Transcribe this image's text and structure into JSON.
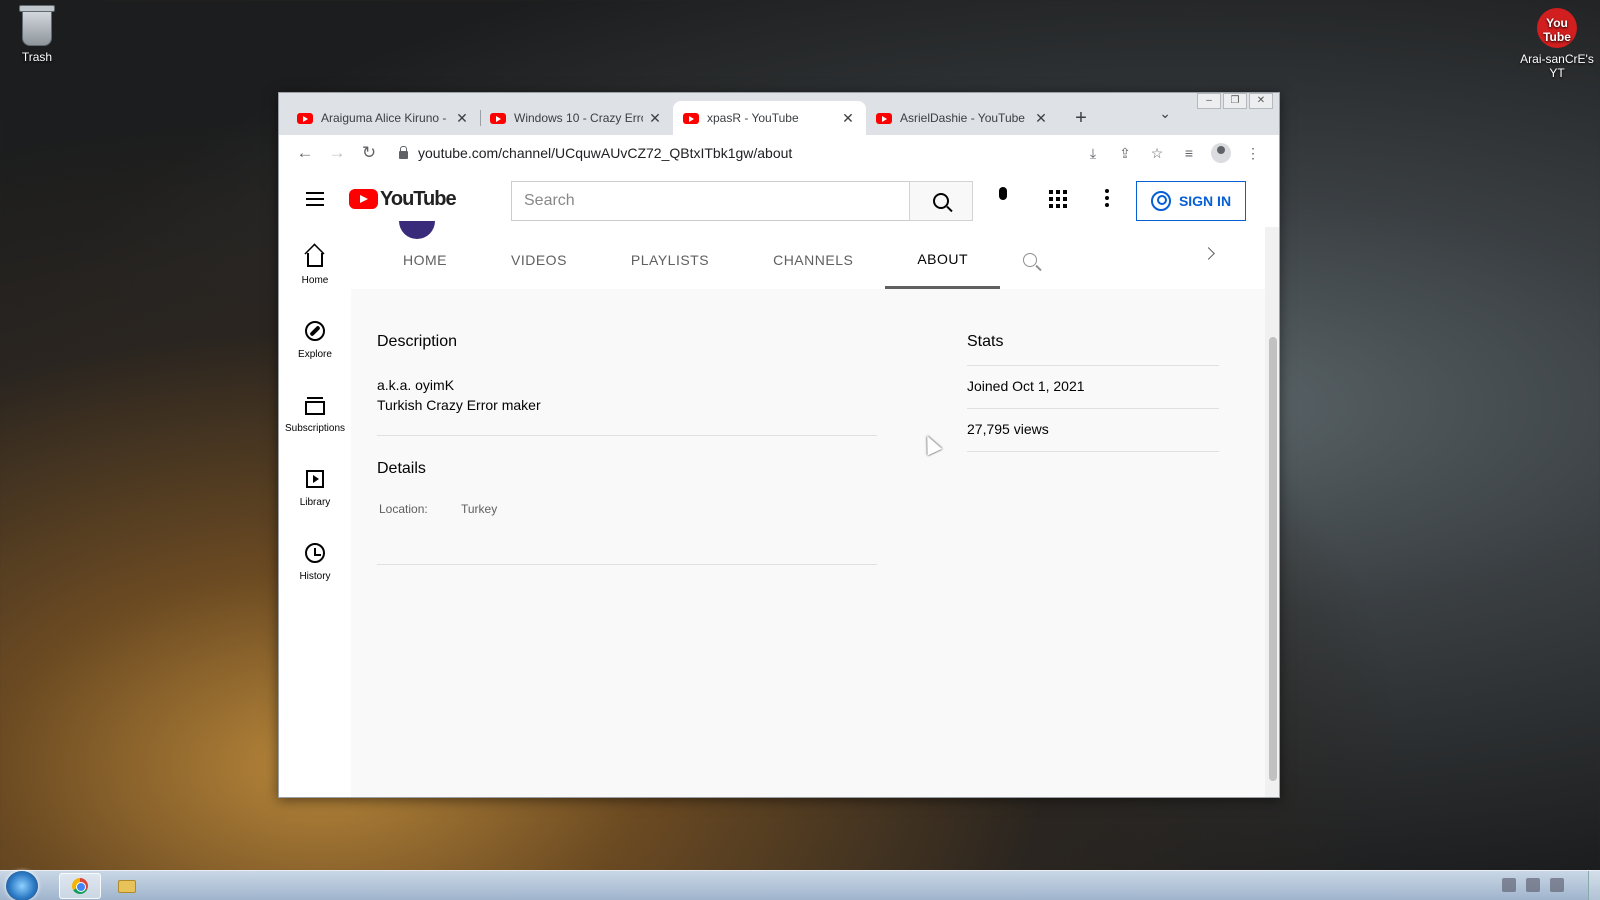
{
  "desktop": {
    "trash_label": "Trash",
    "shortcut_label": "Arai-sanCrE's YT",
    "shortcut_glyph": "You Tube"
  },
  "browser": {
    "tabs": [
      {
        "title": "Araiguma Alice Kiruno -",
        "active": false
      },
      {
        "title": "Windows 10 - Crazy Erro",
        "active": false
      },
      {
        "title": "xpasR - YouTube",
        "active": true
      },
      {
        "title": "AsrielDashie - YouTube",
        "active": false
      }
    ],
    "new_tab": "+",
    "tab_search": "⌄",
    "url": "youtube.com/channel/UCquwAUvCZ72_QBtxITbk1gw/about",
    "window_controls": {
      "minimize": "–",
      "maximize": "❐",
      "close": "✕"
    }
  },
  "youtube": {
    "logo_text": "YouTube",
    "search_placeholder": "Search",
    "sign_in": "SIGN IN",
    "guide": [
      {
        "label": "Home",
        "icon": "home-icon"
      },
      {
        "label": "Explore",
        "icon": "compass-icon"
      },
      {
        "label": "Subscriptions",
        "icon": "subscriptions-icon"
      },
      {
        "label": "Library",
        "icon": "library-icon"
      },
      {
        "label": "History",
        "icon": "history-icon"
      }
    ],
    "channel_tabs": [
      "HOME",
      "VIDEOS",
      "PLAYLISTS",
      "CHANNELS",
      "ABOUT"
    ],
    "active_tab": "ABOUT",
    "about": {
      "description_heading": "Description",
      "description_lines": [
        "a.k.a. oyimK",
        "Turkish Crazy Error maker"
      ],
      "details_heading": "Details",
      "location_label": "Location:",
      "location_value": "Turkey"
    },
    "stats": {
      "heading": "Stats",
      "joined": "Joined Oct 1, 2021",
      "views": "27,795 views"
    }
  },
  "colors": {
    "brand_red": "#ff0000",
    "link_blue": "#065fd4"
  }
}
